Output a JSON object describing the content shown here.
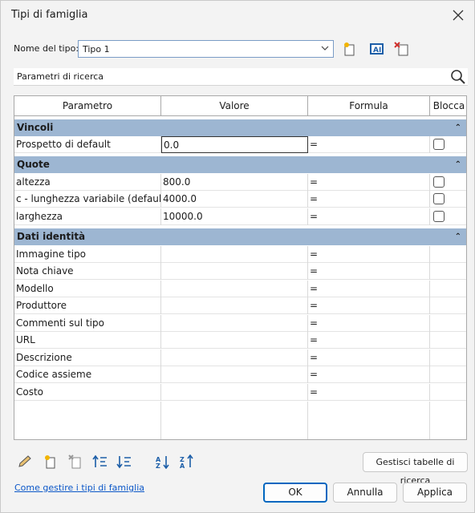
{
  "window": {
    "title": "Tipi di famiglia"
  },
  "type_selector": {
    "label": "Nome del tipo:",
    "value": "Tipo 1"
  },
  "search": {
    "placeholder": "Parametri di ricerca"
  },
  "table": {
    "headers": [
      "Parametro",
      "Valore",
      "Formula",
      "Blocca"
    ],
    "groups": [
      {
        "name": "Vincoli",
        "rows": [
          {
            "param": "Prospetto di default",
            "value": "0.0",
            "formula": "=",
            "lock": false
          }
        ]
      },
      {
        "name": "Quote",
        "rows": [
          {
            "param": "altezza",
            "value": "800.0",
            "formula": "=",
            "lock": false
          },
          {
            "param": "c - lunghezza variabile (default)",
            "value": "4000.0",
            "formula": "=",
            "lock": false
          },
          {
            "param": "larghezza",
            "value": "10000.0",
            "formula": "=",
            "lock": false
          }
        ]
      },
      {
        "name": "Dati identità",
        "rows": [
          {
            "param": "Immagine tipo",
            "value": "",
            "formula": "="
          },
          {
            "param": "Nota chiave",
            "value": "",
            "formula": "="
          },
          {
            "param": "Modello",
            "value": "",
            "formula": "="
          },
          {
            "param": "Produttore",
            "value": "",
            "formula": "="
          },
          {
            "param": "Commenti sul tipo",
            "value": "",
            "formula": "="
          },
          {
            "param": "URL",
            "value": "",
            "formula": "="
          },
          {
            "param": "Descrizione",
            "value": "",
            "formula": "="
          },
          {
            "param": "Codice assieme",
            "value": "",
            "formula": "="
          },
          {
            "param": "Costo",
            "value": "",
            "formula": "="
          }
        ]
      }
    ]
  },
  "bottom": {
    "lookup_button": "Gestisci tabelle di ricerca",
    "help_link": "Come gestire i tipi di famiglia",
    "ok": "OK",
    "cancel": "Annulla",
    "apply": "Applica"
  },
  "icons": [
    "pencil-icon",
    "new-parameter-icon",
    "delete-parameter-icon",
    "move-up-icon",
    "move-down-icon",
    "sort-ascending-icon",
    "sort-descending-icon",
    "search-icon",
    "new-type-icon",
    "rename-type-icon",
    "delete-type-icon"
  ],
  "colors": {
    "group_header": "#9db6d2",
    "accent": "#0067c0",
    "link": "#0b57c8"
  }
}
